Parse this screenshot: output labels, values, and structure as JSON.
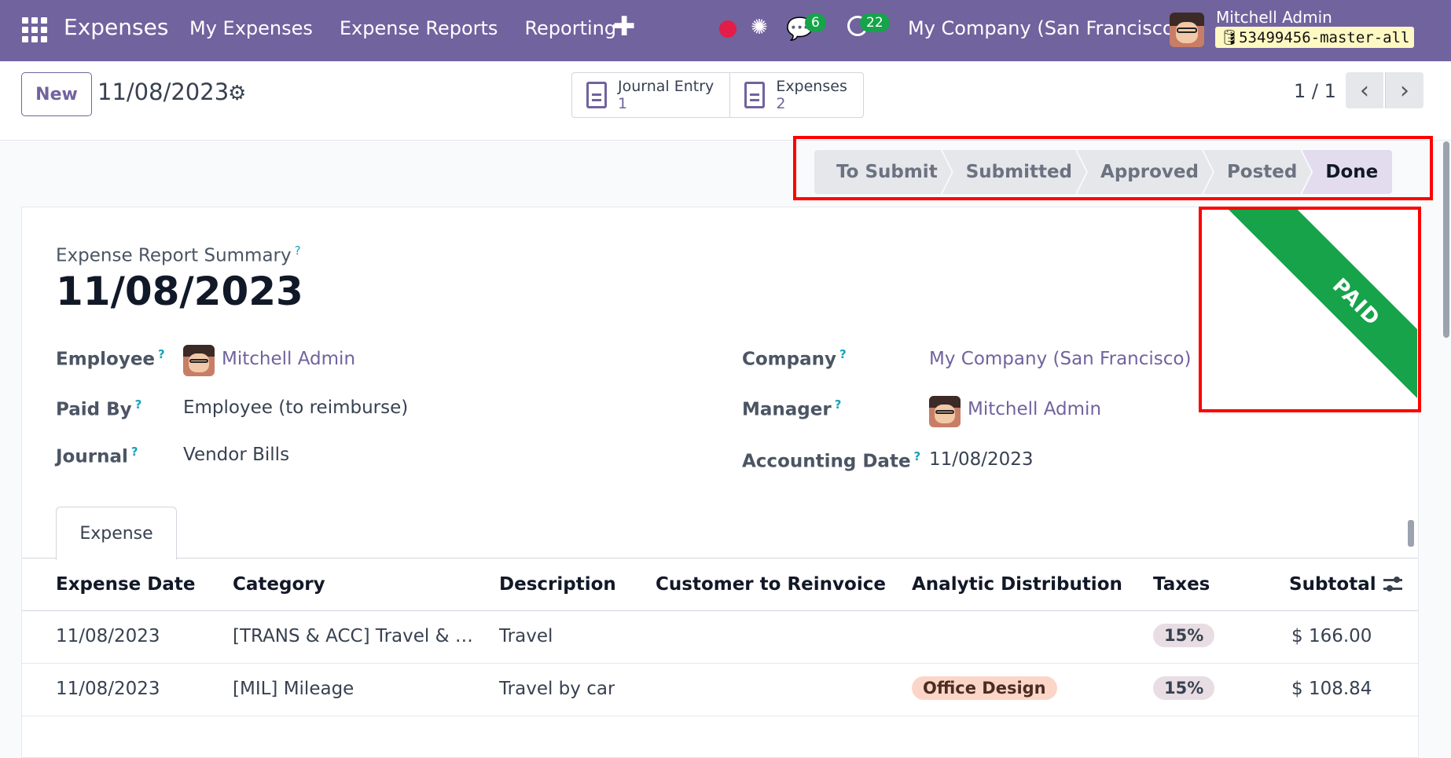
{
  "navbar": {
    "brand": "Expenses",
    "menu": [
      "My Expenses",
      "Expense Reports",
      "Reporting"
    ],
    "plus": "✚",
    "messages_count": "6",
    "activities_count": "22",
    "company": "My Company (San Francisco)",
    "user": "Mitchell Admin",
    "database": "🛢53499456-master-all"
  },
  "control": {
    "new_label": "New",
    "breadcrumb": "11/08/2023",
    "smart_buttons": [
      {
        "label": "Journal Entry",
        "count": "1"
      },
      {
        "label": "Expenses",
        "count": "2"
      }
    ],
    "pager": "1 / 1"
  },
  "status": {
    "stages": [
      "To Submit",
      "Submitted",
      "Approved",
      "Posted",
      "Done"
    ],
    "current": "Done"
  },
  "ribbon": "PAID",
  "form": {
    "summary_label": "Expense Report Summary",
    "title": "11/08/2023",
    "left": [
      {
        "label": "Employee",
        "value": "Mitchell Admin"
      },
      {
        "label": "Paid By",
        "value": "Employee (to reimburse)"
      },
      {
        "label": "Journal",
        "value": "Vendor Bills"
      }
    ],
    "right": [
      {
        "label": "Company",
        "value": "My Company (San Francisco)"
      },
      {
        "label": "Manager",
        "value": "Mitchell Admin"
      },
      {
        "label": "Accounting Date",
        "value": "11/08/2023"
      }
    ]
  },
  "tabs": [
    "Expense"
  ],
  "table": {
    "columns": [
      "Expense Date",
      "Category",
      "Description",
      "Customer to Reinvoice",
      "Analytic Distribution",
      "Taxes",
      "Subtotal"
    ],
    "rows": [
      {
        "date": "11/08/2023",
        "category": "[TRANS & ACC] Travel & Accommodation",
        "description": "Travel",
        "customer": "",
        "analytic": "",
        "taxes": "15%",
        "subtotal": "$ 166.00"
      },
      {
        "date": "11/08/2023",
        "category": "[MIL] Mileage",
        "description": "Travel by car",
        "customer": "",
        "analytic": "Office Design",
        "taxes": "15%",
        "subtotal": "$ 108.84"
      }
    ]
  },
  "colors": {
    "brand": "#71639e",
    "paid_ribbon": "#16a34a",
    "highlight": "#ff0000"
  }
}
